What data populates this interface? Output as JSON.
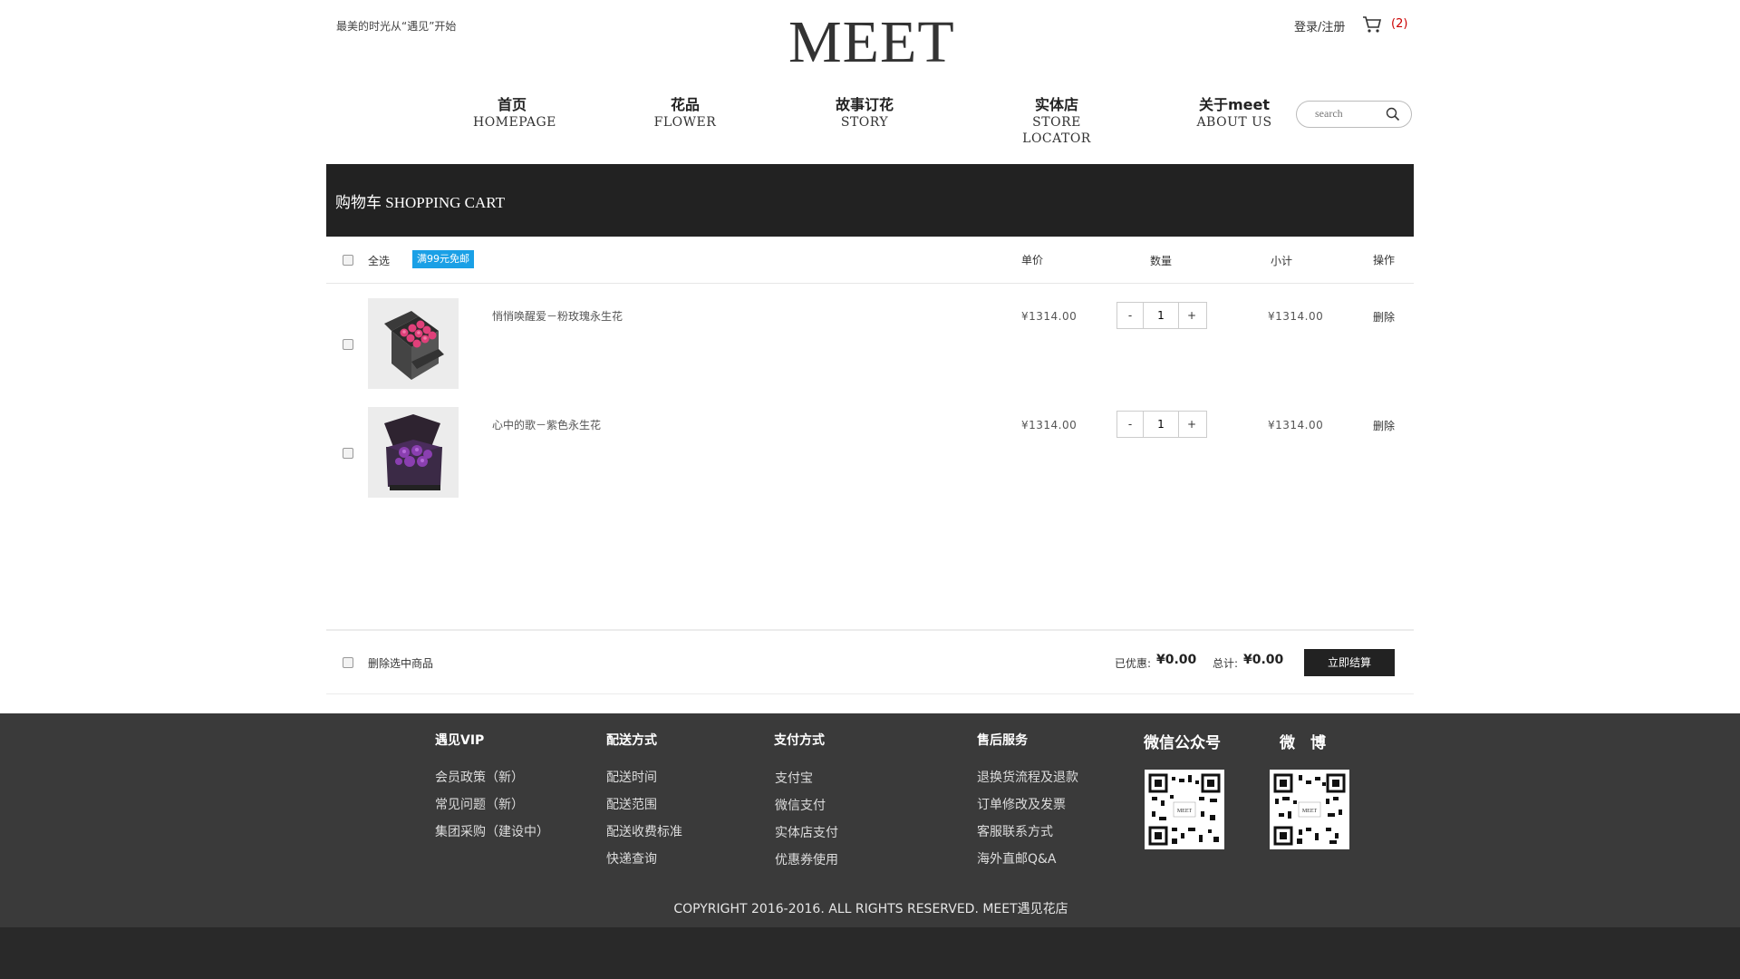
{
  "header": {
    "slogan": "最美的时光从“遇见”开始",
    "logo_text": "MEET",
    "login": "登录/注册",
    "cart_count": "(2)"
  },
  "nav": [
    {
      "zh": "首页",
      "en": "HOMEPAGE"
    },
    {
      "zh": "花品",
      "en": "FLOWER"
    },
    {
      "zh": "故事订花",
      "en": "STORY"
    },
    {
      "zh": "实体店",
      "en": "STORE LOCATOR"
    },
    {
      "zh": "关于meet",
      "en": "ABOUT US"
    }
  ],
  "search": {
    "placeholder": "search"
  },
  "cart": {
    "title": "购物车 SHOPPING CART",
    "select_all": "全选",
    "free_shipping_badge": "满99元免邮",
    "col_price": "单价",
    "col_qty": "数量",
    "col_subtotal": "小计",
    "col_action": "操作",
    "items": [
      {
        "name": "悄悄唤醒爱－粉玫瑰永生花",
        "price": "¥1314.00",
        "qty": "1",
        "subtotal": "¥1314.00",
        "delete": "删除",
        "minus": "-",
        "plus": "+"
      },
      {
        "name": "心中的歌－紫色永生花",
        "price": "¥1314.00",
        "qty": "1",
        "subtotal": "¥1314.00",
        "delete": "删除",
        "minus": "-",
        "plus": "+"
      }
    ],
    "delete_selected": "删除选中商品",
    "discount_label": "已优惠:",
    "discount_value": "¥0.00",
    "total_label": "总计:",
    "total_value": "¥0.00",
    "checkout": "立即结算"
  },
  "footer": {
    "columns": [
      {
        "title": "遇见VIP",
        "links": [
          "会员政策（新）",
          "常见问题（新）",
          "集团采购（建设中）"
        ]
      },
      {
        "title": "配送方式",
        "links": [
          "配送时间",
          "配送范围",
          "配送收费标准",
          "快递查询"
        ]
      },
      {
        "title": "支付方式",
        "links": [
          "支付宝",
          "微信支付",
          "实体店支付",
          "优惠券使用"
        ]
      },
      {
        "title": "售后服务",
        "links": [
          "退换货流程及退款",
          "订单修改及发票",
          "客服联系方式",
          "海外直邮Q&A"
        ]
      }
    ],
    "wechat_title": "微信公众号",
    "weibo_title": "微　博",
    "copyright": "COPYRIGHT 2016-2016. ALL RIGHTS RESERVED. MEET遇见花店"
  },
  "colors": {
    "dark_band": "#222222",
    "badge": "#1aa0e6",
    "footer_bg": "#3a3a3a",
    "cart_count": "#cc0000"
  }
}
